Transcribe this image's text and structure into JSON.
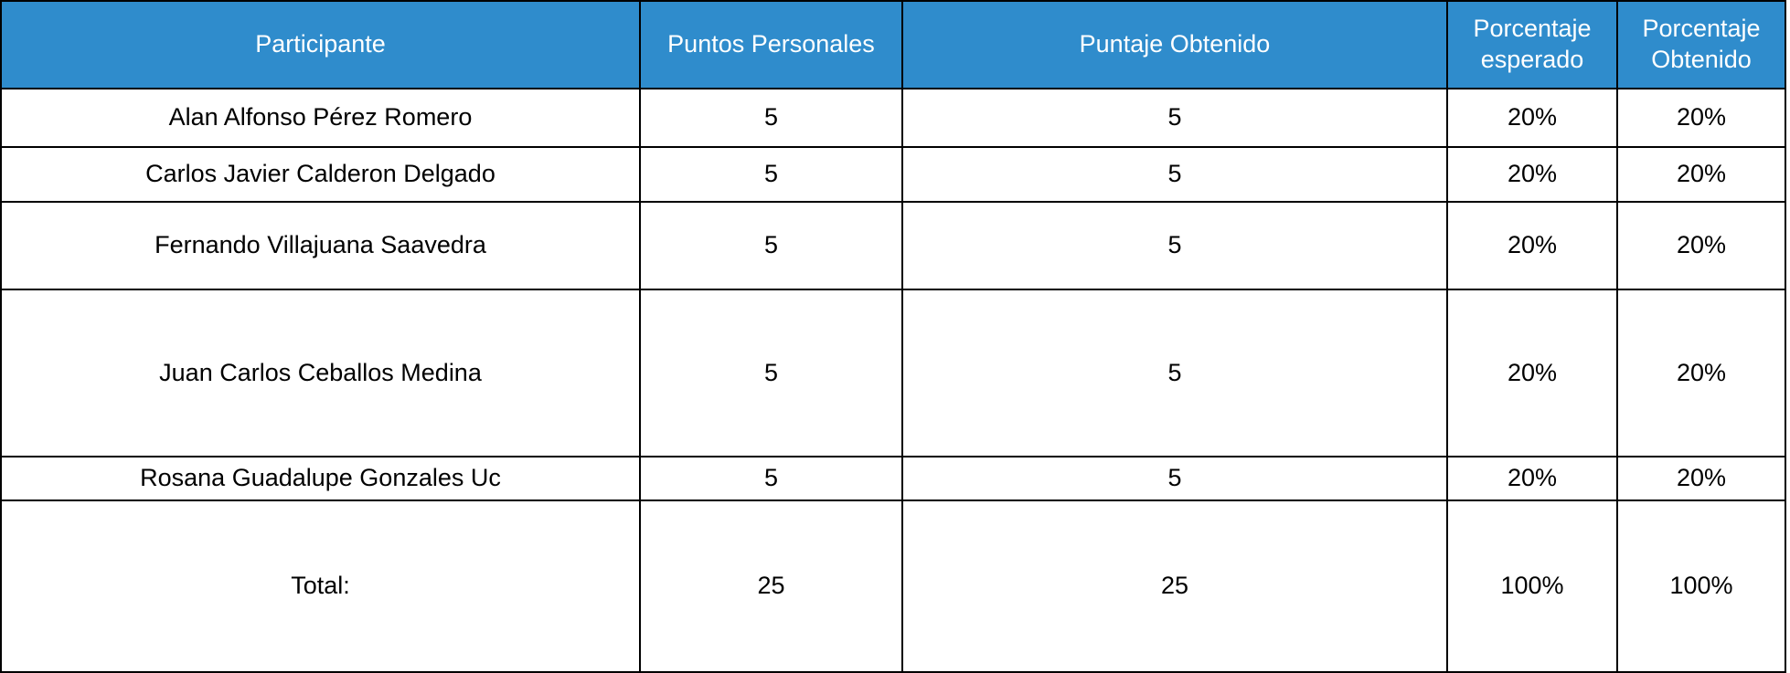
{
  "header": {
    "participante": "Participante",
    "puntos_personales": "Puntos Personales",
    "puntaje_obtenido": "Puntaje Obtenido",
    "porcentaje_esperado_1": "Porcentaje",
    "porcentaje_esperado_2": "esperado",
    "porcentaje_obtenido_1": "Porcentaje",
    "porcentaje_obtenido_2": "Obtenido"
  },
  "rows": [
    {
      "participante": "Alan Alfonso Pérez Romero",
      "puntos": "5",
      "puntaje": "5",
      "esperado": "20%",
      "obtenido": "20%"
    },
    {
      "participante": "Carlos Javier Calderon Delgado",
      "puntos": "5",
      "puntaje": "5",
      "esperado": "20%",
      "obtenido": "20%"
    },
    {
      "participante": "Fernando Villajuana Saavedra",
      "puntos": "5",
      "puntaje": "5",
      "esperado": "20%",
      "obtenido": "20%"
    },
    {
      "participante": "Juan Carlos Ceballos Medina",
      "puntos": "5",
      "puntaje": "5",
      "esperado": "20%",
      "obtenido": "20%"
    },
    {
      "participante": "Rosana Guadalupe Gonzales Uc",
      "puntos": "5",
      "puntaje": "5",
      "esperado": "20%",
      "obtenido": "20%"
    }
  ],
  "total": {
    "label": "Total:",
    "puntos": "25",
    "puntaje": "25",
    "esperado": "100%",
    "obtenido": "100%"
  },
  "colors": {
    "header_bg": "#2f8ccc",
    "header_text": "#ffffff",
    "border": "#000000"
  }
}
